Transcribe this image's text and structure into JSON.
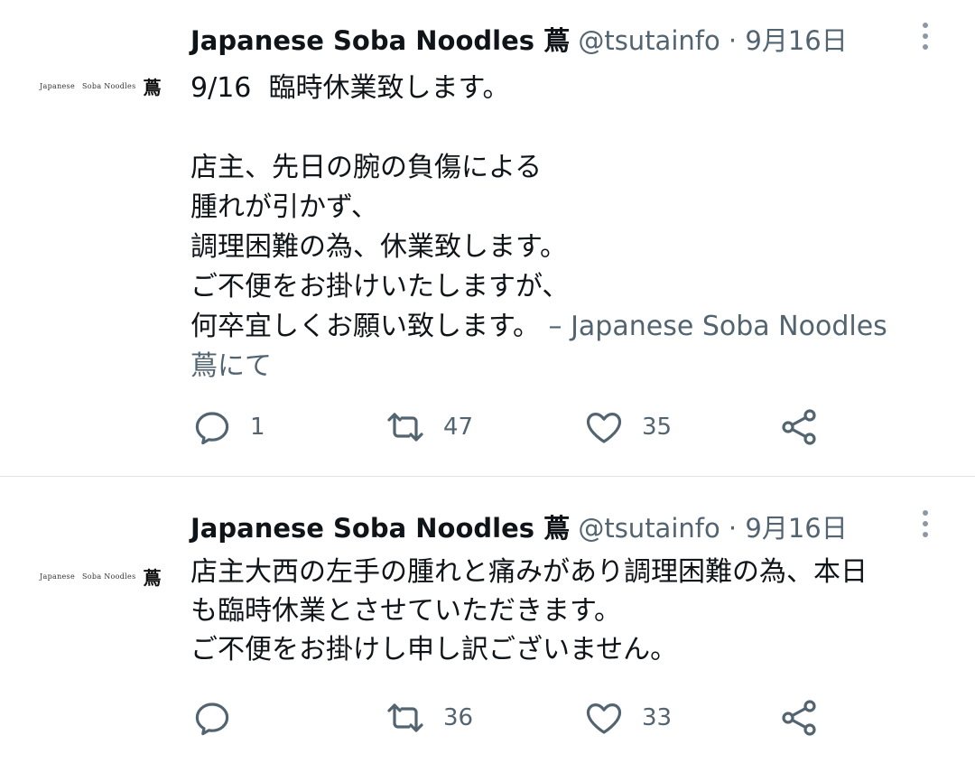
{
  "tweets": [
    {
      "avatar": {
        "left_text": "Japanese",
        "right_text": "Soba Noodles",
        "mark": "蔦"
      },
      "display_name": "Japanese Soba Noodles 蔦",
      "handle": "@tsutainfo",
      "separator": " · ",
      "date": "9月16日",
      "text": "9/16  臨時休業致します。\n\n店主、先日の腕の負傷による\n腫れが引かず、\n調理困難の為、休業致します。\nご不便をお掛けいたしますが、\n何卒宜しくお願い致します。",
      "attribution": " – Japanese Soba Noodles\n蔦にて",
      "replies": "1",
      "retweets": "47",
      "likes": "35"
    },
    {
      "avatar": {
        "left_text": "Japanese",
        "right_text": "Soba Noodles",
        "mark": "蔦"
      },
      "display_name": "Japanese Soba Noodles 蔦",
      "handle": "@tsutainfo",
      "separator": " · ",
      "date": "9月16日",
      "text": "店主大西の左手の腫れと痛みがあり調理困難の為、本日\nも臨時休業とさせていただきます。\nご不便をお掛けし申し訳ございません。",
      "replies": "",
      "retweets": "36",
      "likes": "33"
    }
  ],
  "icons": {
    "reply": "reply-icon",
    "retweet": "retweet-icon",
    "like": "heart-icon",
    "share": "share-icon",
    "more": "more-vertical-icon"
  },
  "colors": {
    "text": "#0f1419",
    "secondary": "#536471",
    "divider": "#dfe3e6",
    "avatar_circle": "#e0101a"
  }
}
